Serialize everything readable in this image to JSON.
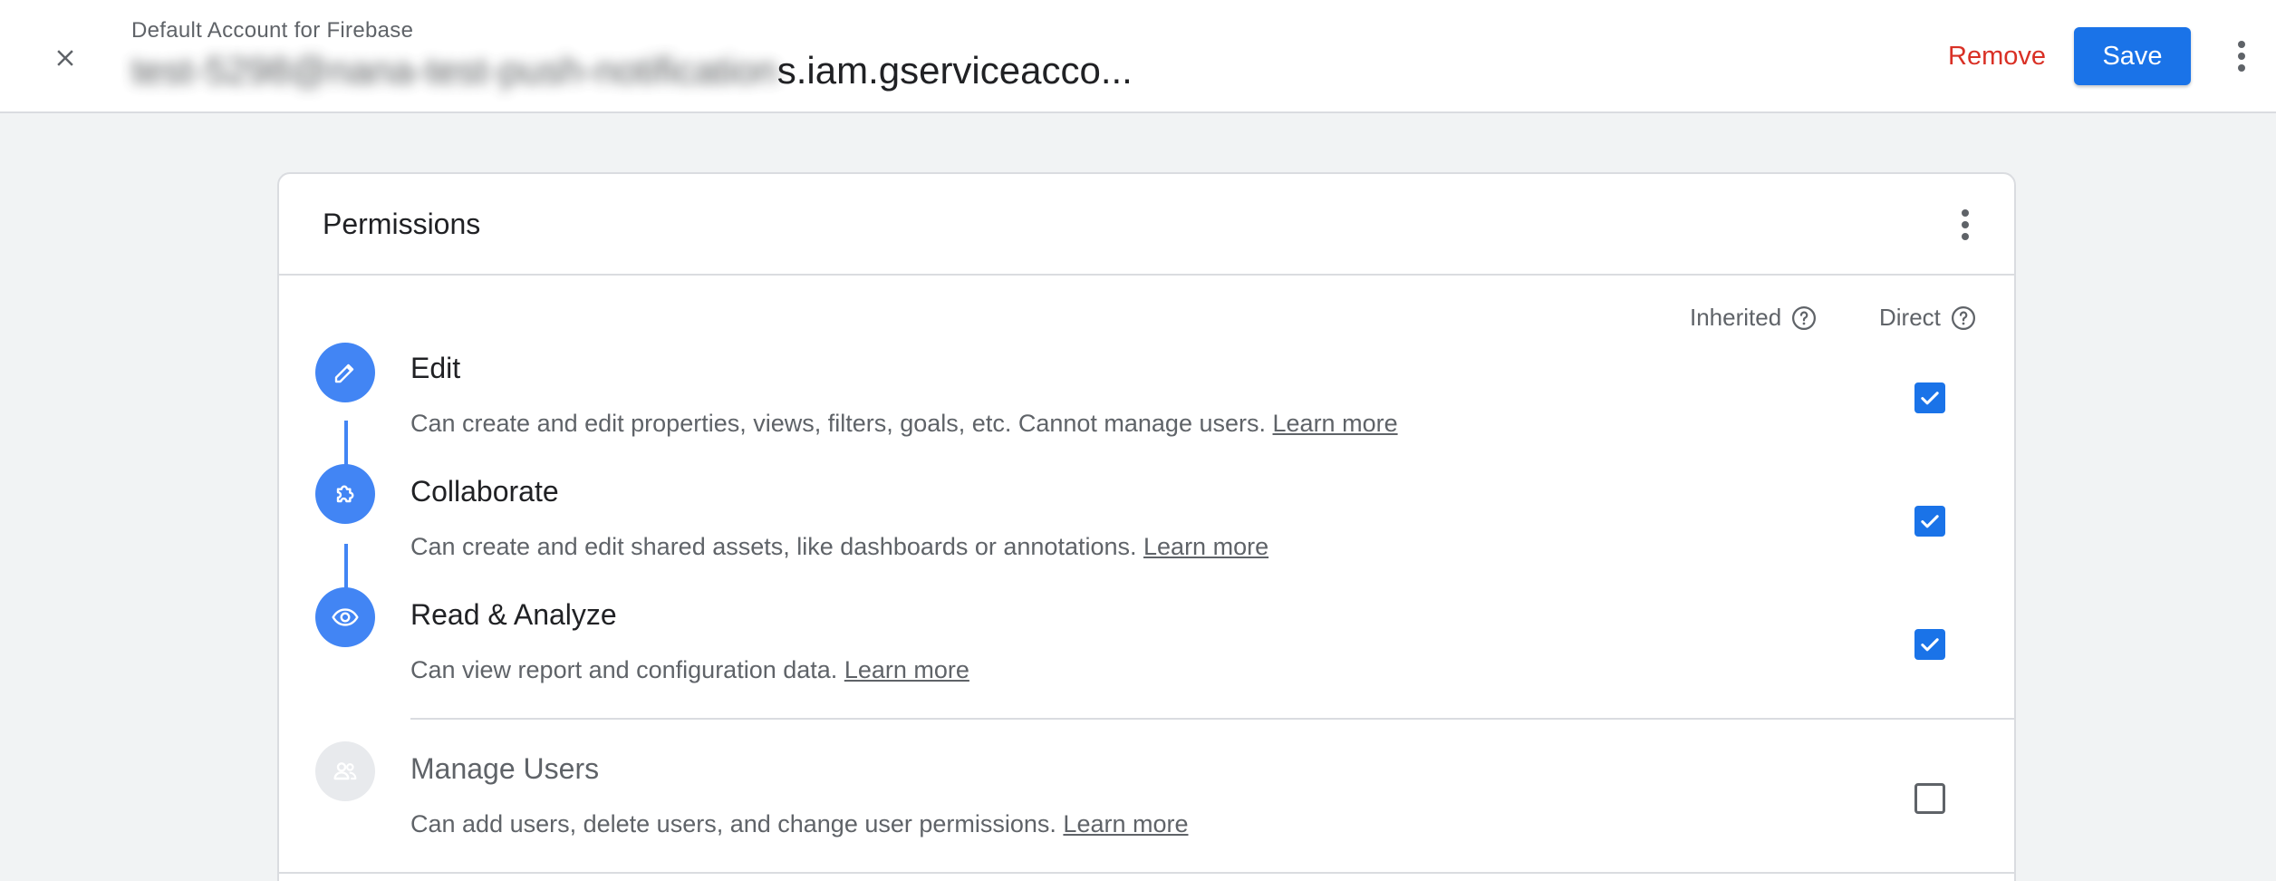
{
  "header": {
    "subtitle": "Default Account for Firebase",
    "title_prefix_blurred": "test-5298@nana-test-push-notification",
    "title_visible": "s.iam.gserviceacco...",
    "remove_label": "Remove",
    "save_label": "Save"
  },
  "permissions": {
    "title": "Permissions",
    "columns": {
      "inherited": "Inherited",
      "direct": "Direct"
    },
    "roles": [
      {
        "name": "Edit",
        "description": "Can create and edit properties, views, filters, goals, etc. Cannot manage users.",
        "link": "Learn more",
        "icon": "pencil-icon",
        "direct": true,
        "enabled": true
      },
      {
        "name": "Collaborate",
        "description": "Can create and edit shared assets, like dashboards or annotations.",
        "link": "Learn more",
        "icon": "puzzle-icon",
        "direct": true,
        "enabled": true
      },
      {
        "name": "Read & Analyze",
        "description": "Can view report and configuration data.",
        "link": "Learn more",
        "icon": "eye-icon",
        "direct": true,
        "enabled": true
      },
      {
        "name": "Manage Users",
        "description": "Can add users, delete users, and change user permissions.",
        "link": "Learn more",
        "icon": "people-icon",
        "direct": false,
        "enabled": false
      }
    ]
  },
  "colors": {
    "accent": "#1a73e8",
    "role_icon": "#4285f4",
    "remove": "#d93025",
    "disabled": "#e8eaed"
  }
}
